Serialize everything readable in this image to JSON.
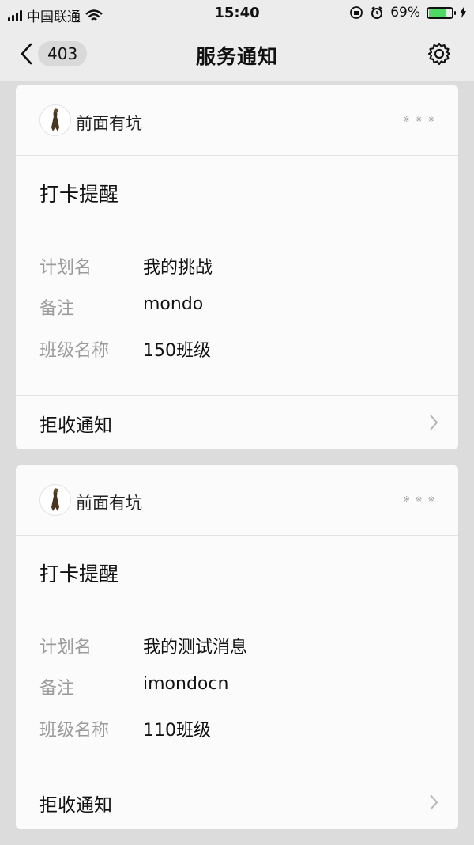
{
  "status": {
    "carrier": "中国联通",
    "time": "15:40",
    "battery": "69%",
    "battery_level": 0.69,
    "icons": [
      "signal-icon",
      "wifi-icon",
      "orientation-lock-icon",
      "alarm-icon",
      "charging-icon"
    ]
  },
  "nav": {
    "badge": "403",
    "title": "服务通知",
    "icons": [
      "back-chevron-icon",
      "gear-icon"
    ]
  },
  "cards": [
    {
      "brand": "前面有坑",
      "more": "※ ※ ※",
      "title": "打卡提醒",
      "fields": [
        {
          "label": "计划名",
          "value": "我的挑战"
        },
        {
          "label": "备注",
          "value": "mondo"
        },
        {
          "label": "班级名称",
          "value": "150班级"
        }
      ],
      "footer": "拒收通知"
    },
    {
      "brand": "前面有坑",
      "more": "※ ※ ※",
      "title": "打卡提醒",
      "fields": [
        {
          "label": "计划名",
          "value": "我的测试消息"
        },
        {
          "label": "备注",
          "value": "imondocn"
        },
        {
          "label": "班级名称",
          "value": "110班级"
        }
      ],
      "footer": "拒收通知"
    }
  ],
  "colors": {
    "background": "#dcdcdc",
    "card": "#fbfbfb",
    "label": "#9b9b9b",
    "battery": "#4cd964"
  }
}
